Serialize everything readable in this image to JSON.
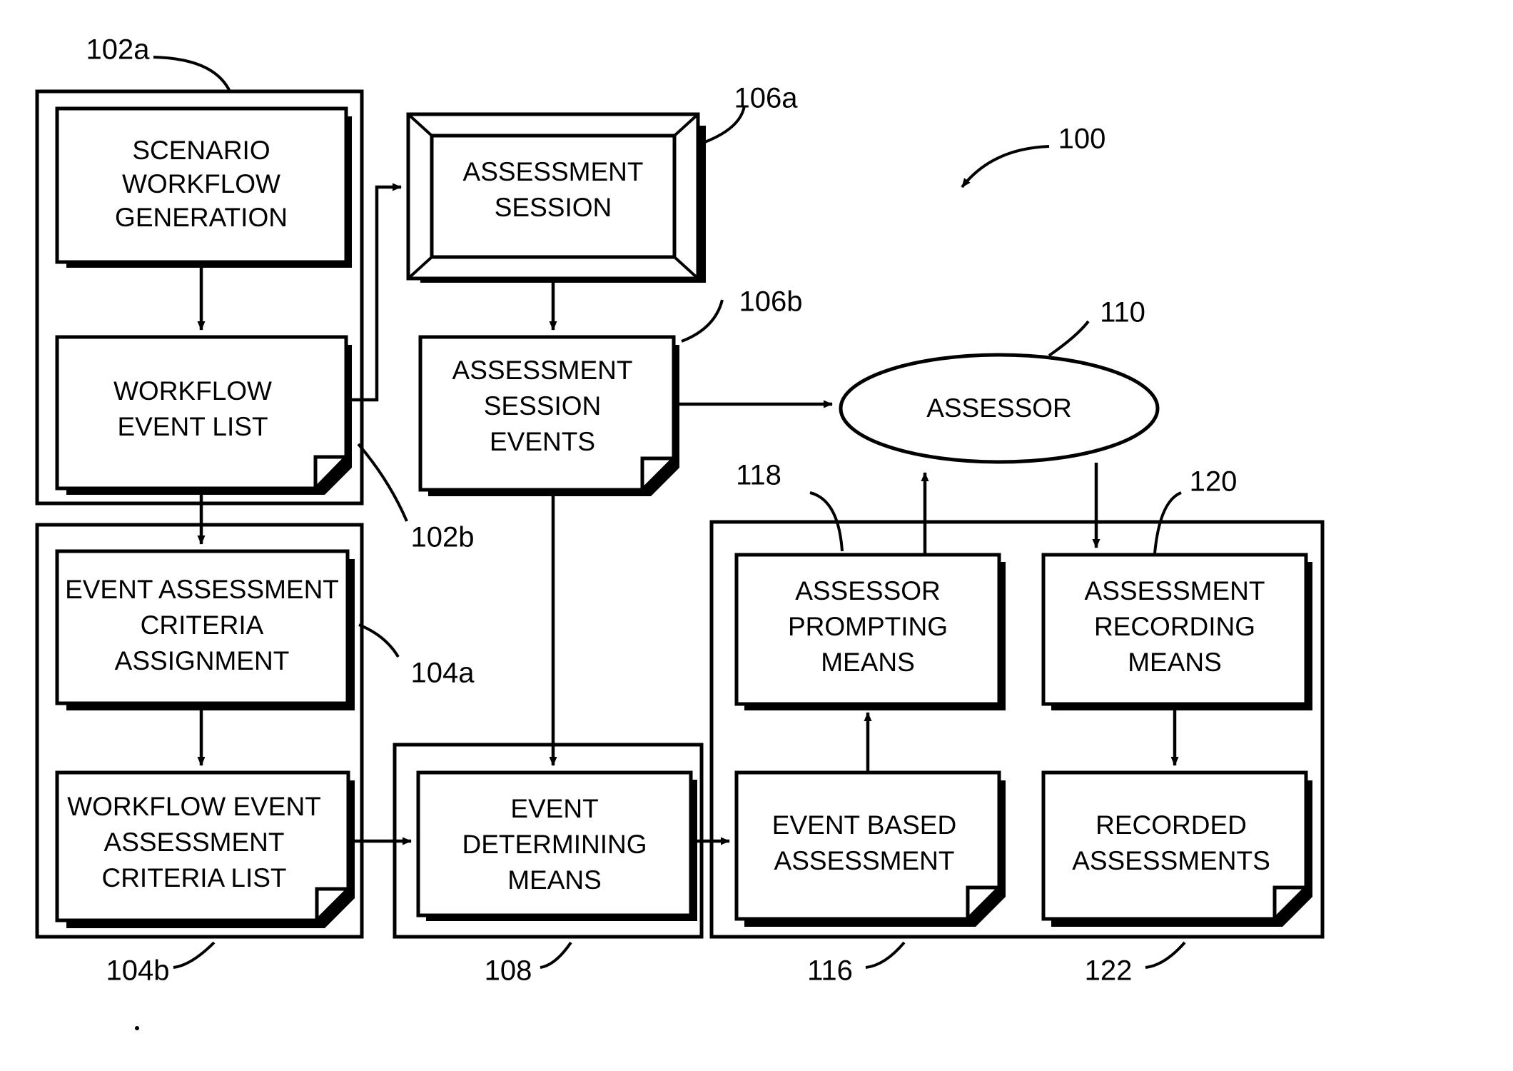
{
  "figure": {
    "id": "100",
    "type": "patent-block-diagram",
    "background_color": "#ffffff",
    "line_color": "#000000"
  },
  "nodes": {
    "scenario_workflow_generation": {
      "label_lines": [
        "SCENARIO",
        "WORKFLOW",
        "GENERATION"
      ],
      "shape": "rectangle",
      "ref": ""
    },
    "workflow_event_list": {
      "label_lines": [
        "WORKFLOW",
        "EVENT LIST"
      ],
      "shape": "document",
      "ref": "102b"
    },
    "assessment_session": {
      "label_lines": [
        "ASSESSMENT",
        "SESSION"
      ],
      "shape": "beveled-frame",
      "ref": "106a"
    },
    "assessment_session_events": {
      "label_lines": [
        "ASSESSMENT",
        "SESSION",
        "EVENTS"
      ],
      "shape": "document",
      "ref": "106b"
    },
    "assessor": {
      "label_lines": [
        "ASSESSOR"
      ],
      "shape": "ellipse",
      "ref": "110"
    },
    "event_assessment_criteria_assignment": {
      "label_lines": [
        "EVENT ASSESSMENT",
        "CRITERIA",
        "ASSIGNMENT"
      ],
      "shape": "rectangle",
      "ref": "104a"
    },
    "workflow_event_assessment_criteria_list": {
      "label_lines": [
        "WORKFLOW EVENT",
        "ASSESSMENT",
        "CRITERIA LIST"
      ],
      "shape": "document",
      "ref": "104b"
    },
    "event_determining_means": {
      "label_lines": [
        "EVENT",
        "DETERMINING",
        "MEANS"
      ],
      "shape": "rectangle",
      "ref": "108"
    },
    "assessor_prompting_means": {
      "label_lines": [
        "ASSESSOR",
        "PROMPTING",
        "MEANS"
      ],
      "shape": "rectangle",
      "ref": "118"
    },
    "assessment_recording_means": {
      "label_lines": [
        "ASSESSMENT",
        "RECORDING",
        "MEANS"
      ],
      "shape": "rectangle",
      "ref": "120"
    },
    "event_based_assessment": {
      "label_lines": [
        "EVENT BASED",
        "ASSESSMENT"
      ],
      "shape": "document",
      "ref": "116"
    },
    "recorded_assessments": {
      "label_lines": [
        "RECORDED",
        "ASSESSMENTS"
      ],
      "shape": "document",
      "ref": "122"
    }
  },
  "group_refs": {
    "top_left_group": "102a",
    "mid_left_group": "104a",
    "figure_ref": "100"
  },
  "ref_labels": {
    "r102a": "102a",
    "r102b": "102b",
    "r104a": "104a",
    "r104b": "104b",
    "r106a": "106a",
    "r106b": "106b",
    "r108": "108",
    "r110": "110",
    "r116": "116",
    "r118": "118",
    "r120": "120",
    "r122": "122",
    "r100": "100"
  },
  "text": {
    "scenario_1": "SCENARIO",
    "scenario_2": "WORKFLOW",
    "scenario_3": "GENERATION",
    "wfel_1": "WORKFLOW",
    "wfel_2": "EVENT LIST",
    "as_1": "ASSESSMENT",
    "as_2": "SESSION",
    "ase_1": "ASSESSMENT",
    "ase_2": "SESSION",
    "ase_3": "EVENTS",
    "assessor_1": "ASSESSOR",
    "eaca_1": "EVENT ASSESSMENT",
    "eaca_2": "CRITERIA",
    "eaca_3": "ASSIGNMENT",
    "weacl_1": "WORKFLOW EVENT",
    "weacl_2": "ASSESSMENT",
    "weacl_3": "CRITERIA LIST",
    "edm_1": "EVENT",
    "edm_2": "DETERMINING",
    "edm_3": "MEANS",
    "apm_1": "ASSESSOR",
    "apm_2": "PROMPTING",
    "apm_3": "MEANS",
    "arm_1": "ASSESSMENT",
    "arm_2": "RECORDING",
    "arm_3": "MEANS",
    "eba_1": "EVENT BASED",
    "eba_2": "ASSESSMENT",
    "ra_1": "RECORDED",
    "ra_2": "ASSESSMENTS"
  }
}
